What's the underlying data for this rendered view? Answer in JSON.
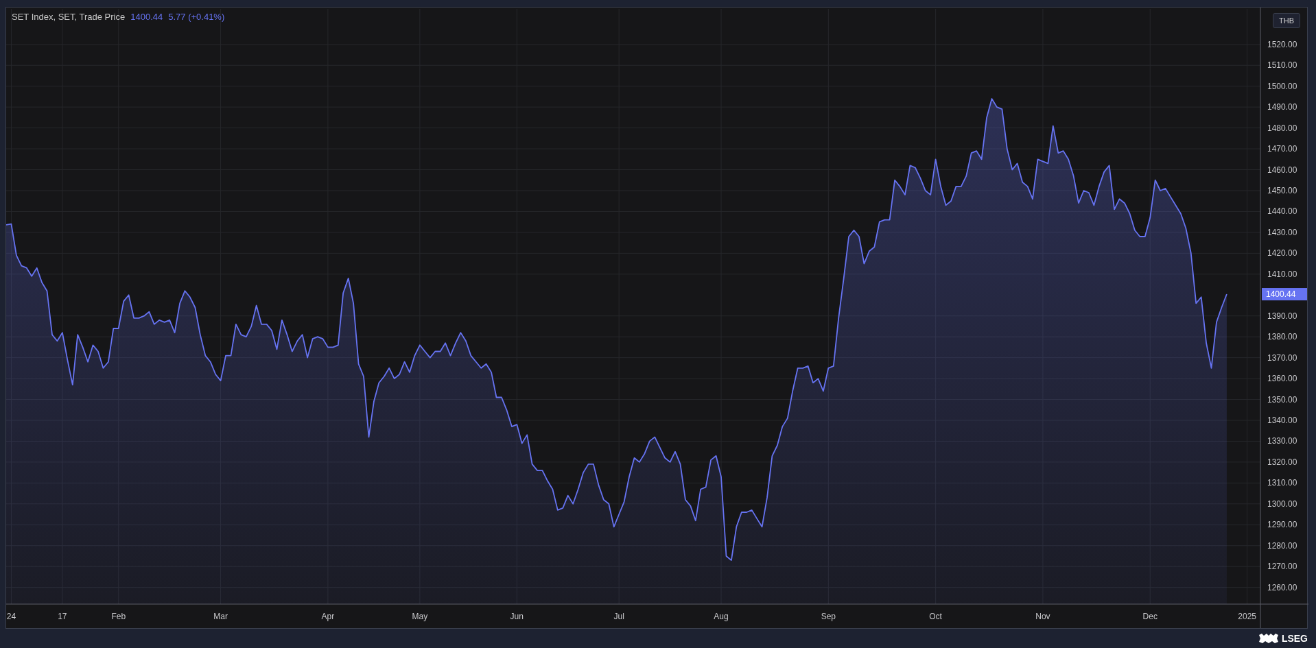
{
  "legend": {
    "title": "SET Index, SET, Trade Price",
    "last": "1400.44",
    "change": "5.77 (+0.41%)"
  },
  "currency_button": "THB",
  "last_price_label": "1400.44",
  "footer": {
    "logo": "LSEG"
  },
  "chart": {
    "chart_data": {
      "type": "area",
      "grid": true,
      "ylim": [
        1252,
        1537
      ],
      "categories": [
        null,
        "24",
        null,
        null,
        null,
        null,
        null,
        null,
        null,
        null,
        null,
        "17",
        null,
        null,
        null,
        null,
        null,
        null,
        null,
        null,
        null,
        null,
        "Feb",
        null,
        null,
        null,
        null,
        null,
        null,
        null,
        null,
        null,
        null,
        null,
        null,
        null,
        null,
        null,
        null,
        null,
        null,
        null,
        "Mar",
        null,
        null,
        null,
        null,
        null,
        null,
        null,
        null,
        null,
        null,
        null,
        null,
        null,
        null,
        null,
        null,
        null,
        null,
        null,
        null,
        "Apr",
        null,
        null,
        null,
        null,
        null,
        null,
        null,
        null,
        null,
        null,
        null,
        null,
        null,
        null,
        null,
        null,
        null,
        "May",
        null,
        null,
        null,
        null,
        null,
        null,
        null,
        null,
        null,
        null,
        null,
        null,
        null,
        null,
        null,
        null,
        null,
        null,
        "Jun",
        null,
        null,
        null,
        null,
        null,
        null,
        null,
        null,
        null,
        null,
        null,
        null,
        null,
        null,
        null,
        null,
        null,
        null,
        null,
        "Jul",
        null,
        null,
        null,
        null,
        null,
        null,
        null,
        null,
        null,
        null,
        null,
        null,
        null,
        null,
        null,
        null,
        null,
        null,
        null,
        "Aug",
        null,
        null,
        null,
        null,
        null,
        null,
        null,
        null,
        null,
        null,
        null,
        null,
        null,
        null,
        null,
        null,
        null,
        null,
        null,
        null,
        "Sep",
        null,
        null,
        null,
        null,
        null,
        null,
        null,
        null,
        null,
        null,
        null,
        null,
        null,
        null,
        null,
        null,
        null,
        null,
        null,
        null,
        "Oct",
        null,
        null,
        null,
        null,
        null,
        null,
        null,
        null,
        null,
        null,
        null,
        null,
        null,
        null,
        null,
        null,
        null,
        null,
        null,
        null,
        "Nov",
        null,
        null,
        null,
        null,
        null,
        null,
        null,
        null,
        null,
        null,
        null,
        null,
        null,
        null,
        null,
        null,
        null,
        null,
        null,
        null,
        "Dec",
        null,
        null,
        null,
        null,
        null,
        null,
        null,
        null,
        null,
        null,
        null,
        null,
        null,
        null,
        null,
        null,
        null,
        null,
        "2025",
        null,
        null
      ],
      "yticks": [
        {
          "value": 1260,
          "label": "1260.00"
        },
        {
          "value": 1270,
          "label": "1270.00"
        },
        {
          "value": 1280,
          "label": "1280.00"
        },
        {
          "value": 1290,
          "label": "1290.00"
        },
        {
          "value": 1300,
          "label": "1300.00"
        },
        {
          "value": 1310,
          "label": "1310.00"
        },
        {
          "value": 1320,
          "label": "1320.00"
        },
        {
          "value": 1330,
          "label": "1330.00"
        },
        {
          "value": 1340,
          "label": "1340.00"
        },
        {
          "value": 1350,
          "label": "1350.00"
        },
        {
          "value": 1360,
          "label": "1360.00"
        },
        {
          "value": 1370,
          "label": "1370.00"
        },
        {
          "value": 1380,
          "label": "1380.00"
        },
        {
          "value": 1390,
          "label": "1390.00"
        },
        {
          "value": 1410,
          "label": "1410.00"
        },
        {
          "value": 1420,
          "label": "1420.00"
        },
        {
          "value": 1430,
          "label": "1430.00"
        },
        {
          "value": 1440,
          "label": "1440.00"
        },
        {
          "value": 1450,
          "label": "1450.00"
        },
        {
          "value": 1460,
          "label": "1460.00"
        },
        {
          "value": 1470,
          "label": "1470.00"
        },
        {
          "value": 1480,
          "label": "1480.00"
        },
        {
          "value": 1490,
          "label": "1490.00"
        },
        {
          "value": 1500,
          "label": "1500.00"
        },
        {
          "value": 1510,
          "label": "1510.00"
        },
        {
          "value": 1520,
          "label": "1520.00"
        }
      ],
      "series": [
        {
          "color": "#6673f2",
          "values": [
            1433.6,
            1434,
            1419,
            1414,
            1413,
            1409,
            1413,
            1406,
            1402,
            1381,
            1378,
            1382,
            1369,
            1357,
            1381,
            1375,
            1368,
            1376,
            1373,
            1365,
            1368,
            1384,
            1384,
            1397,
            1400,
            1389,
            1389,
            1390,
            1392,
            1386,
            1388,
            1387,
            1388,
            1382,
            1396,
            1402,
            1399,
            1394,
            1381,
            1371,
            1368,
            1362,
            1359,
            1371,
            1371,
            1386,
            1381,
            1380,
            1385,
            1395,
            1386,
            1386,
            1383,
            1374,
            1388,
            1381,
            1373,
            1378,
            1381,
            1370,
            1379,
            1380,
            1379,
            1375,
            1375,
            1376,
            1401,
            1408,
            1396,
            1367,
            1361,
            1332,
            1349,
            1358,
            1361,
            1365,
            1360,
            1362,
            1368,
            1363,
            1371,
            1376,
            1373,
            1370,
            1373,
            1373,
            1377,
            1371,
            1377,
            1382,
            1378,
            1371,
            1368,
            1365,
            1367,
            1363,
            1351,
            1351,
            1345,
            1337,
            1338,
            1329,
            1333,
            1319,
            1316,
            1316,
            1311,
            1307,
            1297,
            1298,
            1304,
            1300,
            1307,
            1315,
            1319,
            1319,
            1309,
            1302,
            1300,
            1289,
            1295,
            1301,
            1313,
            1322,
            1320,
            1324,
            1330,
            1332,
            1327,
            1322,
            1320,
            1325,
            1319,
            1302,
            1299,
            1292,
            1307,
            1308,
            1321,
            1323,
            1313,
            1275,
            1273,
            1289,
            1296,
            1296,
            1297,
            1293,
            1289,
            1303,
            1323,
            1328,
            1337,
            1341,
            1354,
            1365,
            1365,
            1366,
            1358,
            1360,
            1354,
            1365,
            1366,
            1389,
            1408,
            1428,
            1431,
            1428,
            1415,
            1421,
            1423,
            1435,
            1436,
            1436,
            1455,
            1452,
            1448,
            1462,
            1461,
            1456,
            1450,
            1448,
            1465,
            1452,
            1443,
            1445,
            1452,
            1452,
            1457,
            1468,
            1469,
            1465,
            1485,
            1494,
            1490,
            1489,
            1470,
            1460,
            1463,
            1454,
            1452,
            1446,
            1465,
            1464,
            1463,
            1481,
            1468,
            1469,
            1465,
            1457,
            1444,
            1450,
            1449,
            1443,
            1452,
            1459,
            1462,
            1441,
            1446,
            1444,
            1439,
            1431,
            1428,
            1428,
            1437,
            1455,
            1450,
            1451,
            1447,
            1443,
            1439,
            1432,
            1420,
            1396,
            1399,
            1377,
            1365,
            1387,
            1394,
            1400.4,
            null,
            null,
            null,
            null,
            null,
            null
          ]
        }
      ]
    }
  }
}
